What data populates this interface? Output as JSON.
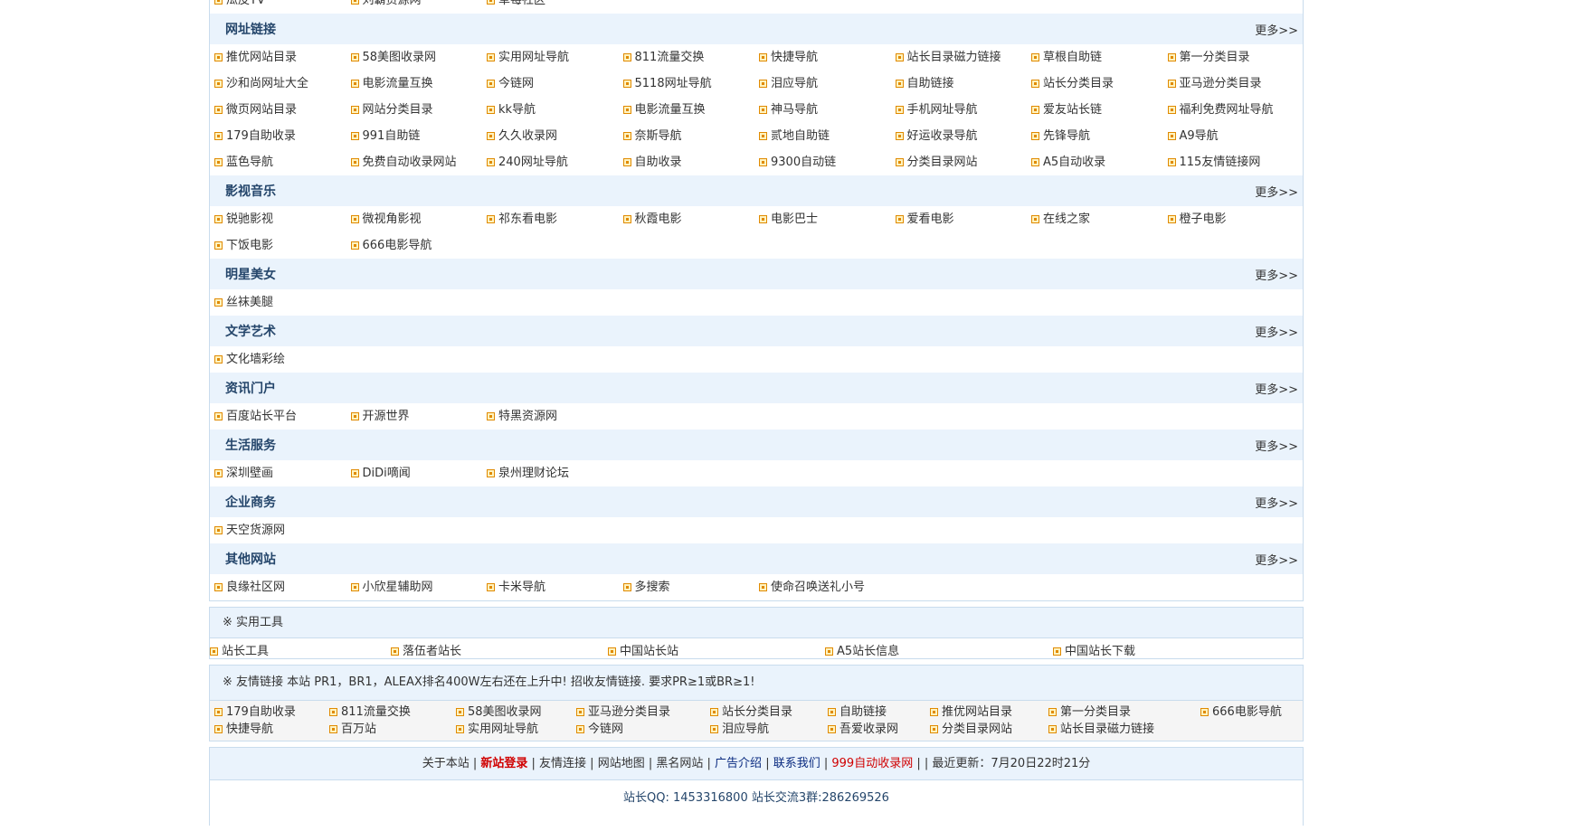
{
  "top_row": [
    "瓜皮TV",
    "刘霸资源网",
    "草莓社区"
  ],
  "more_label": "更多>>",
  "categories": [
    {
      "title": "网址链接",
      "links": [
        "推优网站目录",
        "58美图收录网",
        "实用网址导航",
        "811流量交换",
        "快捷导航",
        "站长目录磁力链接",
        "草根自助链",
        "第一分类目录",
        "沙和尚网址大全",
        "电影流量互换",
        "今链网",
        "5118网址导航",
        "泪应导航",
        "自助链接",
        "站长分类目录",
        "亚马逊分类目录",
        "微页网站目录",
        "网站分类目录",
        "kk导航",
        "电影流量互换",
        "神马导航",
        "手机网址导航",
        "爱友站长链",
        "福利免费网址导航",
        "179自助收录",
        "991自助链",
        "久久收录网",
        "奈斯导航",
        "贰地自助链",
        "好运收录导航",
        "先锋导航",
        "A9导航",
        "蓝色导航",
        "免费自动收录网站",
        "240网址导航",
        "自助收录",
        "9300自动链",
        "分类目录网站",
        "A5自动收录",
        "115友情链接网"
      ]
    },
    {
      "title": "影视音乐",
      "links": [
        "锐驰影视",
        "微视角影视",
        "祁东看电影",
        "秋霞电影",
        "电影巴士",
        "爱看电影",
        "在线之家",
        "橙子电影",
        "下饭电影",
        "666电影导航"
      ]
    },
    {
      "title": "明星美女",
      "links": [
        "丝袜美腿"
      ]
    },
    {
      "title": "文学艺术",
      "links": [
        "文化墙彩绘"
      ]
    },
    {
      "title": "资讯门户",
      "links": [
        "百度站长平台",
        "开源世界",
        "特黑资源网"
      ]
    },
    {
      "title": "生活服务",
      "links": [
        "深圳壁画",
        "DiDi嘀闻",
        "泉州理财论坛"
      ]
    },
    {
      "title": "企业商务",
      "links": [
        "天空货源网"
      ]
    },
    {
      "title": "其他网站",
      "links": [
        "良缘社区网",
        "小欣星辅助网",
        "卡米导航",
        "多搜索",
        "使命召唤送礼小号"
      ]
    }
  ],
  "tools": {
    "title": "※ 实用工具",
    "links": [
      "站长工具",
      "落伍者站长",
      "中国站长站",
      "A5站长信息",
      "中国站长下载"
    ]
  },
  "friends": {
    "title": "※ 友情链接 本站 PR1，BR1，ALEAX排名400W左右还在上升中! 招收友情链接. 要求PR≥1或BR≥1!",
    "links": [
      "179自助收录",
      "811流量交换",
      "58美图收录网",
      "亚马逊分类目录",
      "站长分类目录",
      "自助链接",
      "推优网站目录",
      "第一分类目录",
      "666电影导航",
      "快捷导航",
      "百万站",
      "实用网址导航",
      "今链网",
      "泪应导航",
      "吾爱收录网",
      "分类目录网站",
      "站长目录磁力链接"
    ]
  },
  "footer": {
    "about": "关于本站",
    "login": "新站登录",
    "friend_links": "友情连接",
    "sitemap": "网站地图",
    "blacklist": "黑名网站",
    "ads": "广告介绍",
    "contact": "联系我们",
    "auto": "999自动收录网",
    "updated": "最近更新：7月20日22时21分",
    "qq": "站长QQ: 1453316800 站长交流3群:286269526"
  }
}
